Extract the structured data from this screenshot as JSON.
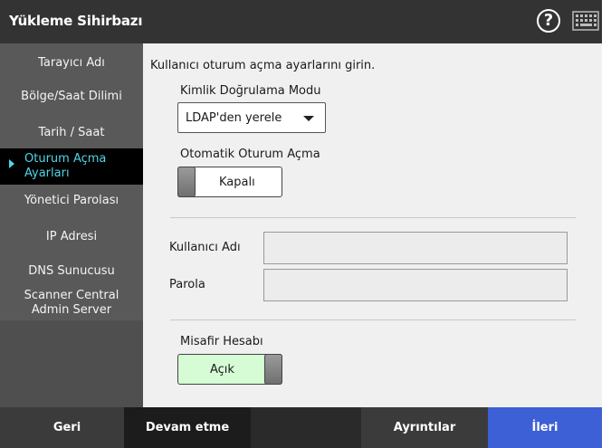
{
  "app": {
    "title": "Yükleme Sihirbazı"
  },
  "header": {
    "help_glyph": "?"
  },
  "sidebar": {
    "items": [
      {
        "label": "Tarayıcı Adı"
      },
      {
        "label": "Bölge/Saat Dilimi"
      },
      {
        "label": "Tarih / Saat"
      },
      {
        "label_line1": "Oturum Açma",
        "label_line2": "Ayarları",
        "active": true
      },
      {
        "label": "Yönetici Parolası"
      },
      {
        "label": "IP Adresi"
      },
      {
        "label": "DNS Sunucusu"
      },
      {
        "label_line1": "Scanner Central",
        "label_line2": "Admin Server"
      }
    ]
  },
  "main": {
    "instruction": "Kullanıcı oturum açma ayarlarını girin.",
    "auth_mode": {
      "label": "Kimlik Doğrulama Modu",
      "value": "LDAP'den yerele"
    },
    "auto_login": {
      "label": "Otomatik Oturum Açma",
      "state": "Kapalı"
    },
    "username": {
      "label": "Kullanıcı Adı",
      "value": ""
    },
    "password": {
      "label": "Parola",
      "value": ""
    },
    "guest": {
      "label": "Misafir Hesabı",
      "state": "Açık"
    }
  },
  "footer": {
    "back": "Geri",
    "continue": "Devam etme",
    "details": "Ayrıntılar",
    "next": "İleri"
  },
  "colors": {
    "titlebar": "#333333",
    "sidebar": "#595959",
    "active_text": "#4fd6e6",
    "toggle_on": "#d5fcd5",
    "next_button": "#3d60d6"
  }
}
